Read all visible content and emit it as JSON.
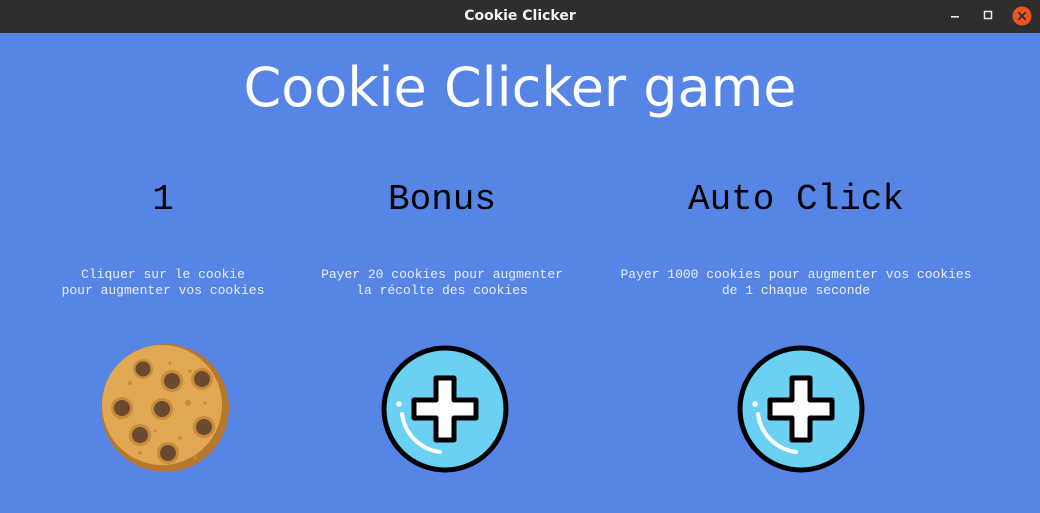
{
  "window": {
    "title": "Cookie Clicker",
    "controls": [
      "minimize-icon",
      "maximize-icon",
      "close-icon"
    ],
    "close_color": "#e95420"
  },
  "app": {
    "heading": "Cookie Clicker game",
    "background_color": "#5785e6"
  },
  "columns": [
    {
      "label": "1",
      "description": "Cliquer sur le cookie\npour augmenter vos cookies",
      "icon": "cookie-icon"
    },
    {
      "label": "Bonus",
      "description": "Payer 20 cookies pour augmenter\nla récolte des cookies",
      "icon": "plus-circle-icon"
    },
    {
      "label": "Auto Click",
      "description": "Payer 1000 cookies pour augmenter vos cookies\nde 1 chaque seconde",
      "icon": "plus-circle-icon"
    }
  ]
}
